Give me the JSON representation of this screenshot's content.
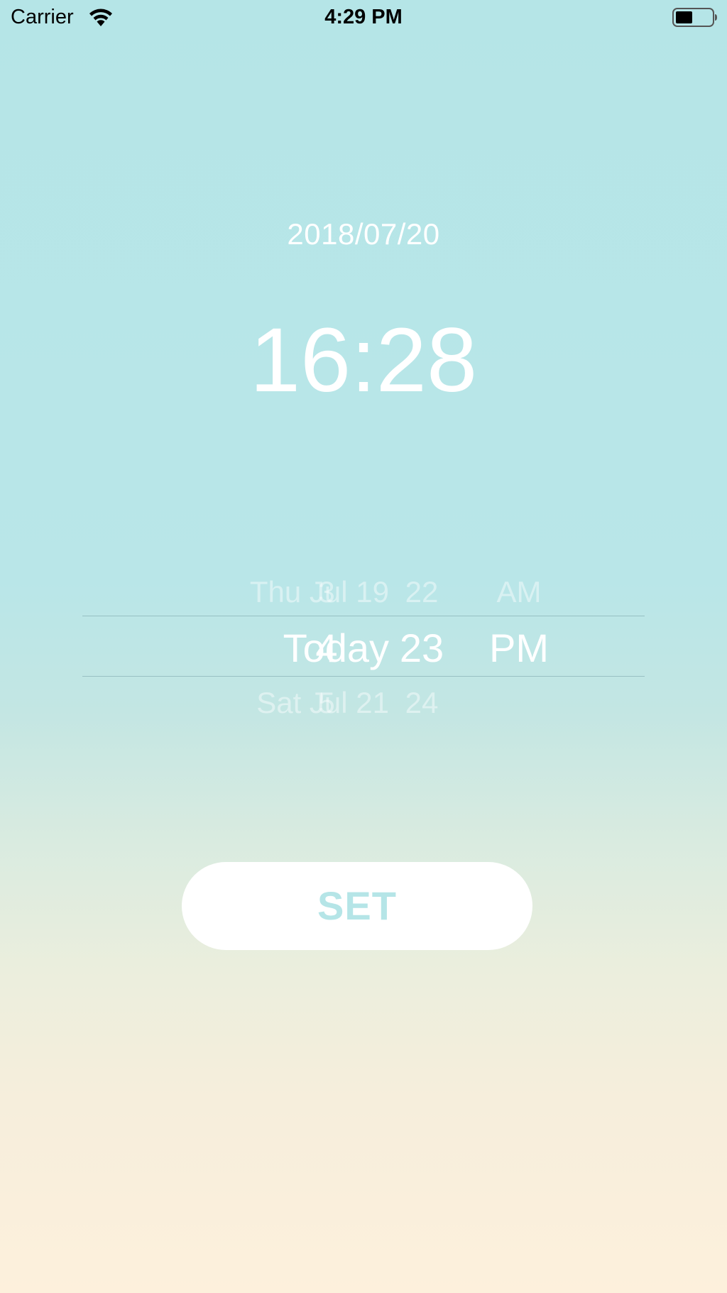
{
  "status_bar": {
    "carrier": "Carrier",
    "time": "4:29 PM",
    "wifi_icon": "wifi-icon",
    "battery_icon": "battery-icon"
  },
  "display": {
    "date": "2018/07/20",
    "time": "16:28"
  },
  "picker": {
    "date_column": {
      "above": "Thu Jul 19",
      "selected": "Today",
      "below": "Sat Jul 21"
    },
    "hour_column": {
      "above": "3",
      "selected": "4",
      "below": "5"
    },
    "minute_column": {
      "above": "22",
      "selected": "23",
      "below": "24"
    },
    "ampm_column": {
      "above": "AM",
      "selected": "PM"
    }
  },
  "set_button": {
    "label": "SET"
  },
  "colors": {
    "gradient_top": "#b5e5e7",
    "gradient_bottom": "#fdf0dc",
    "accent": "#b5e5e7",
    "text": "#ffffff"
  }
}
